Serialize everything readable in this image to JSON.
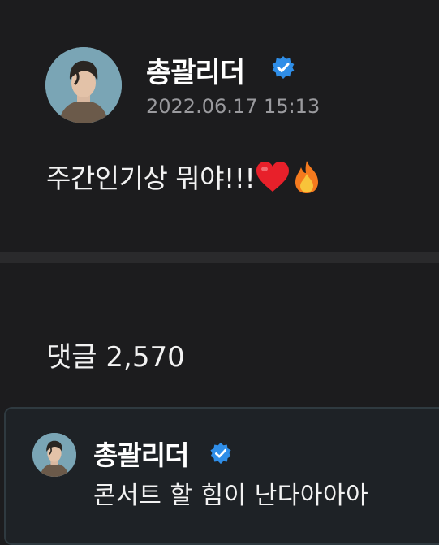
{
  "post": {
    "author_name": "총괄리더",
    "timestamp": "2022.06.17 15:13",
    "text": "주간인기상 뭐야!!!",
    "emojis": [
      "heart-emoji",
      "fire-emoji"
    ]
  },
  "comments": {
    "label": "댓글",
    "count": "2,570",
    "items": [
      {
        "author": "총괄리더",
        "text": "콘서트 할 힘이 난다아아아"
      }
    ]
  },
  "colors": {
    "background": "#1c1c1e",
    "verified_badge": "#2f8ee8",
    "timestamp": "#9a9a9e",
    "heart": "#e8202a",
    "fire": "#f5a020"
  }
}
